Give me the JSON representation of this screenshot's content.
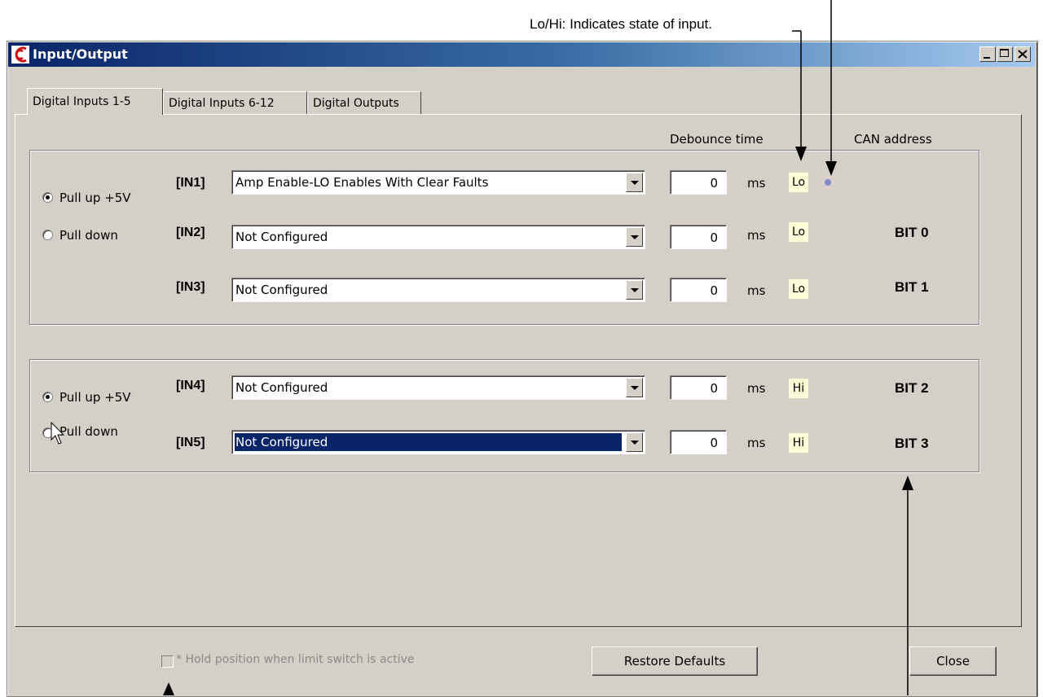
{
  "annotation": {
    "text": "Lo/Hi: Indicates state of input."
  },
  "window": {
    "title": "Input/Output"
  },
  "tabs": [
    {
      "label": "Digital Inputs 1-5"
    },
    {
      "label": "Digital Inputs 6-12"
    },
    {
      "label": "Digital Outputs"
    }
  ],
  "headers": {
    "debounce": "Debounce time",
    "can": "CAN address"
  },
  "group1": {
    "pullup_label": "Pull up +5V",
    "pulldown_label": "Pull down",
    "selected": "pullup"
  },
  "group2": {
    "pullup_label": "Pull up +5V",
    "pulldown_label": "Pull down",
    "selected": "pullup"
  },
  "inputs": [
    {
      "label": "[IN1]",
      "function": "Amp Enable-LO Enables With Clear Faults",
      "debounce": "0",
      "unit": "ms",
      "state": "Lo",
      "can": ""
    },
    {
      "label": "[IN2]",
      "function": "Not Configured",
      "debounce": "0",
      "unit": "ms",
      "state": "Lo",
      "can": "BIT 0"
    },
    {
      "label": "[IN3]",
      "function": "Not Configured",
      "debounce": "0",
      "unit": "ms",
      "state": "Lo",
      "can": "BIT 1"
    },
    {
      "label": "[IN4]",
      "function": "Not Configured",
      "debounce": "0",
      "unit": "ms",
      "state": "Hi",
      "can": "BIT 2"
    },
    {
      "label": "[IN5]",
      "function": "Not Configured",
      "debounce": "0",
      "unit": "ms",
      "state": "Hi",
      "can": "BIT 3"
    }
  ],
  "footer": {
    "hold_label": "* Hold position when limit switch is active",
    "restore": "Restore Defaults",
    "close": "Close"
  },
  "colors": {
    "titlebar": "#0a246a",
    "state_bg": "#ffffd8",
    "selection": "#0a246a"
  }
}
